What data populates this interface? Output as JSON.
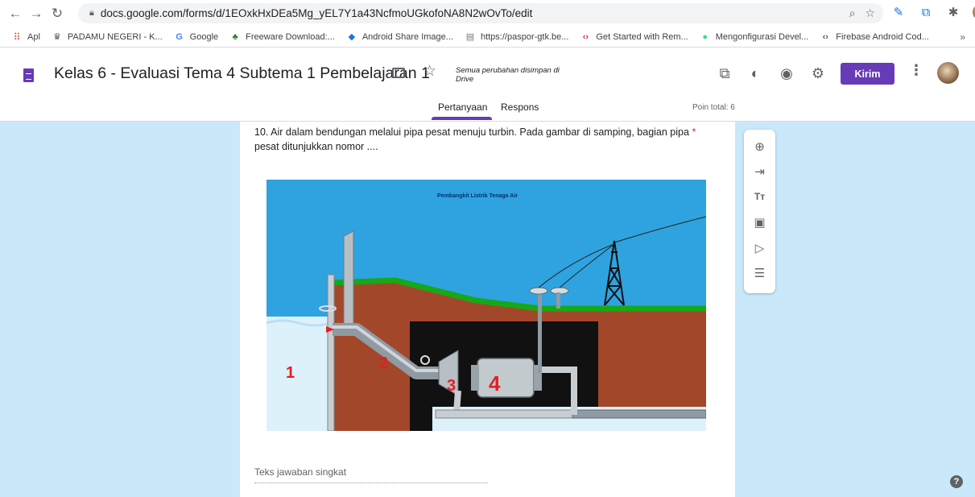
{
  "browser": {
    "url": "docs.google.com/forms/d/1EOxkHxDEa5Mg_yEL7Y1a43NcfmoUGkofoNA8N2wOvTo/edit",
    "bookmarks": [
      {
        "label": "Apl",
        "icon": "apps-grid-icon"
      },
      {
        "label": "PADAMU NEGERI - K...",
        "icon": "emblem-icon"
      },
      {
        "label": "Google",
        "icon": "google-icon"
      },
      {
        "label": "Freeware Download:...",
        "icon": "palm-icon"
      },
      {
        "label": "Android Share Image...",
        "icon": "share-icon"
      },
      {
        "label": "https://paspor-gtk.be...",
        "icon": "page-icon"
      },
      {
        "label": "Get Started with Rem...",
        "icon": "code-icon"
      },
      {
        "label": "Mengonfigurasi Devel...",
        "icon": "android-icon"
      },
      {
        "label": "Firebase Android Cod...",
        "icon": "code-icon"
      }
    ],
    "more": "»"
  },
  "header": {
    "title": "Kelas 6 - Evaluasi Tema 4 Subtema 1 Pembelajaran 1",
    "saved_status": "Semua perubahan disimpan di Drive",
    "send_label": "Kirim",
    "tabs": [
      {
        "label": "Pertanyaan",
        "active": true
      },
      {
        "label": "Respons",
        "active": false
      }
    ],
    "points": "Poin total: 6"
  },
  "question": {
    "text": "10. Air dalam bendungan melalui pipa pesat menuju turbin. Pada gambar di samping, bagian pipa",
    "text_cont": "pesat ditunjukkan nomor ....",
    "required_mark": "*",
    "answer_placeholder": "Teks jawaban singkat"
  },
  "figure": {
    "caption": "Pembangkit Listrik Tenaga Air",
    "labels": [
      "1",
      "2",
      "3",
      "4"
    ],
    "colors": {
      "sky": "#2fa3df",
      "earth": "#a3472a",
      "grass": "#17a817",
      "cavern": "#111111",
      "water": "#ddf1fb",
      "pipe": "#8f9aa3"
    }
  },
  "theme": {
    "accent": "#673ab7",
    "background": "#c9e8fa"
  }
}
